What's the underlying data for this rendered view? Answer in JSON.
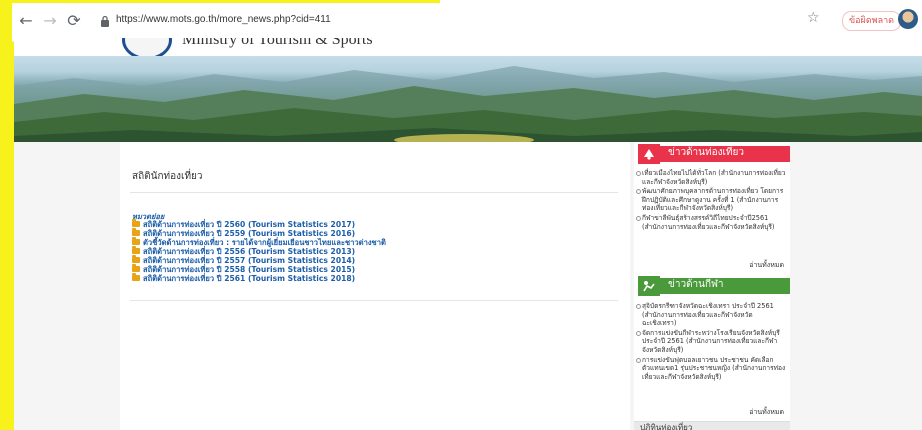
{
  "browser": {
    "back_icon": "back-arrow-icon",
    "forward_icon": "forward-arrow-icon",
    "reload_icon": "reload-icon",
    "url": "https://www.mots.go.th/more_news.php?cid=411",
    "profile_label": "ข้อผิดพลาด"
  },
  "site": {
    "title": "Ministry of Tourism & Sports"
  },
  "main": {
    "title": "สถิตินักท่องเที่ยว",
    "category_label": "หมวดย่อย",
    "items": [
      "สถิติด้านการท่องเที่ยว ปี 2560 (Tourism Statistics 2017)",
      "สถิติด้านการท่องเที่ยว ปี 2559 (Tourism Statistics 2016)",
      "ตัวชี้วัดด้านการท่องเที่ยว : รายได้จากผู้เยี่ยมเยือนชาวไทยและชาวต่างชาติ",
      "สถิติด้านการท่องเที่ยว ปี 2556 (Tourism Statistics 2013)",
      "สถิติด้านการท่องเที่ยว ปี 2557 (Tourism Statistics 2014)",
      "สถิติด้านการท่องเที่ยว ปี 2558 (Tourism Statistics 2015)",
      "สถิติด้านการท่องเที่ยว ปี 2561 (Tourism Statistics 2018)"
    ]
  },
  "sidebar": {
    "tourism_news": {
      "title": "ข่าวด้านท่องเที่ยว",
      "accent": "#e8334a",
      "items": [
        "เที่ยวเมืองไทยไปได้ทั่วโลก (สำนักงานการท่องเที่ยวและกีฬาจังหวัดสิงห์บุรี)",
        "พัฒนาศักยภาพบุคลากรด้านการท่องเที่ยว โดยการฝึกปฏิบัติและศึกษาดูงาน ครั้งที่ 1 (สำนักงานการท่องเที่ยวและกีฬาจังหวัดสิงห์บุรี)",
        "กีฬาขาลีพันธุ์สร้างสรรค์วิถีไทยประจำปี2561 (สำนักงานการท่องเที่ยวและกีฬาจังหวัดสิงห์บุรี)"
      ],
      "read_all": "อ่านทั้งหมด"
    },
    "sports_news": {
      "title": "ข่าวด้านกีฬา",
      "accent": "#4a9a3c",
      "items": [
        "สุจิบัตรกรีฑาจังหวัดฉะเชิงเทรา ประจำปี 2561 (สำนักงานการท่องเที่ยวและกีฬาจังหวัดฉะเชิงเทรา)",
        "จัดการแข่งขันกีฬาระหว่างโรงเรียนจังหวัดสิงห์บุรี ประจำปี 2561 (สำนักงานการท่องเที่ยวและกีฬาจังหวัดสิงห์บุรี)",
        "การแข่งขันฟุตบอลเยาวชน ประชาชน คัดเลือกตัวแทนเขต1 รุ่นประชาชนหญิง (สำนักงานการท่องเที่ยวและกีฬาจังหวัดสิงห์บุรี)"
      ],
      "read_all": "อ่านทั้งหมด"
    },
    "third_header": "ปฏิทินท่องเที่ยว"
  },
  "colors": {
    "highlight": "#f7f21c",
    "link": "#1d5ea8",
    "folder": "#e8a317"
  }
}
